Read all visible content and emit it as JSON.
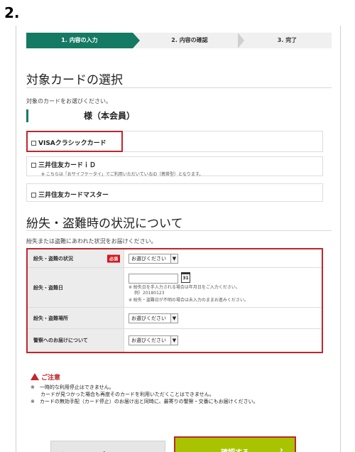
{
  "step_number": "2.",
  "progress": {
    "steps": [
      {
        "label": "1. 内容の入力",
        "active": true
      },
      {
        "label": "2. 内容の確認",
        "active": false
      },
      {
        "label": "3. 完了",
        "active": false
      }
    ]
  },
  "card_section": {
    "title": "対象カードの選択",
    "instruction": "対象のカードをお選びください。",
    "member_label": "様（本会員）",
    "cards": [
      {
        "name": "VISAクラシックカード",
        "note": ""
      },
      {
        "name": "三井住友カードｉＤ",
        "note": "※ こちらは「おサイフケータイ」でご利用いただいているiD（携帯型）となります。"
      },
      {
        "name": "三井住友カードマスター",
        "note": ""
      }
    ]
  },
  "situation_section": {
    "title": "紛失・盗難時の状況について",
    "instruction": "紛失または盗難にあわれた状況をお届けください。",
    "required_badge": "必須",
    "fields": [
      {
        "label": "紛失・盗難の状況",
        "value": "お選びください"
      },
      {
        "label": "紛失・盗難日",
        "notes": [
          "※ 紛失日を手入力される場合は年月日をご入力ください。",
          "例）20180123",
          "※ 紛失・盗難日が不明の場合は未入力のままお進みください。"
        ],
        "calendar_day": "31"
      },
      {
        "label": "紛失・盗難場所",
        "value": "お選びください"
      },
      {
        "label": "警察へのお届けについて",
        "value": "お選びください"
      }
    ]
  },
  "caution": {
    "title": "ご注意",
    "items": [
      "※　一時的な利用停止はできません。",
      "　　カードが見つかった場合も再度そのカードを利用いただくことはできません。",
      "※　カードの無効手配（カード停止）のお届け出と同時に、最寄りの警察・交番にもお届けください。"
    ]
  },
  "buttons": {
    "back": "戻る",
    "confirm": "確認する"
  },
  "colors": {
    "accent_green": "#147a63",
    "highlight_red": "#c0262d",
    "confirm_button": "#a9c300"
  }
}
